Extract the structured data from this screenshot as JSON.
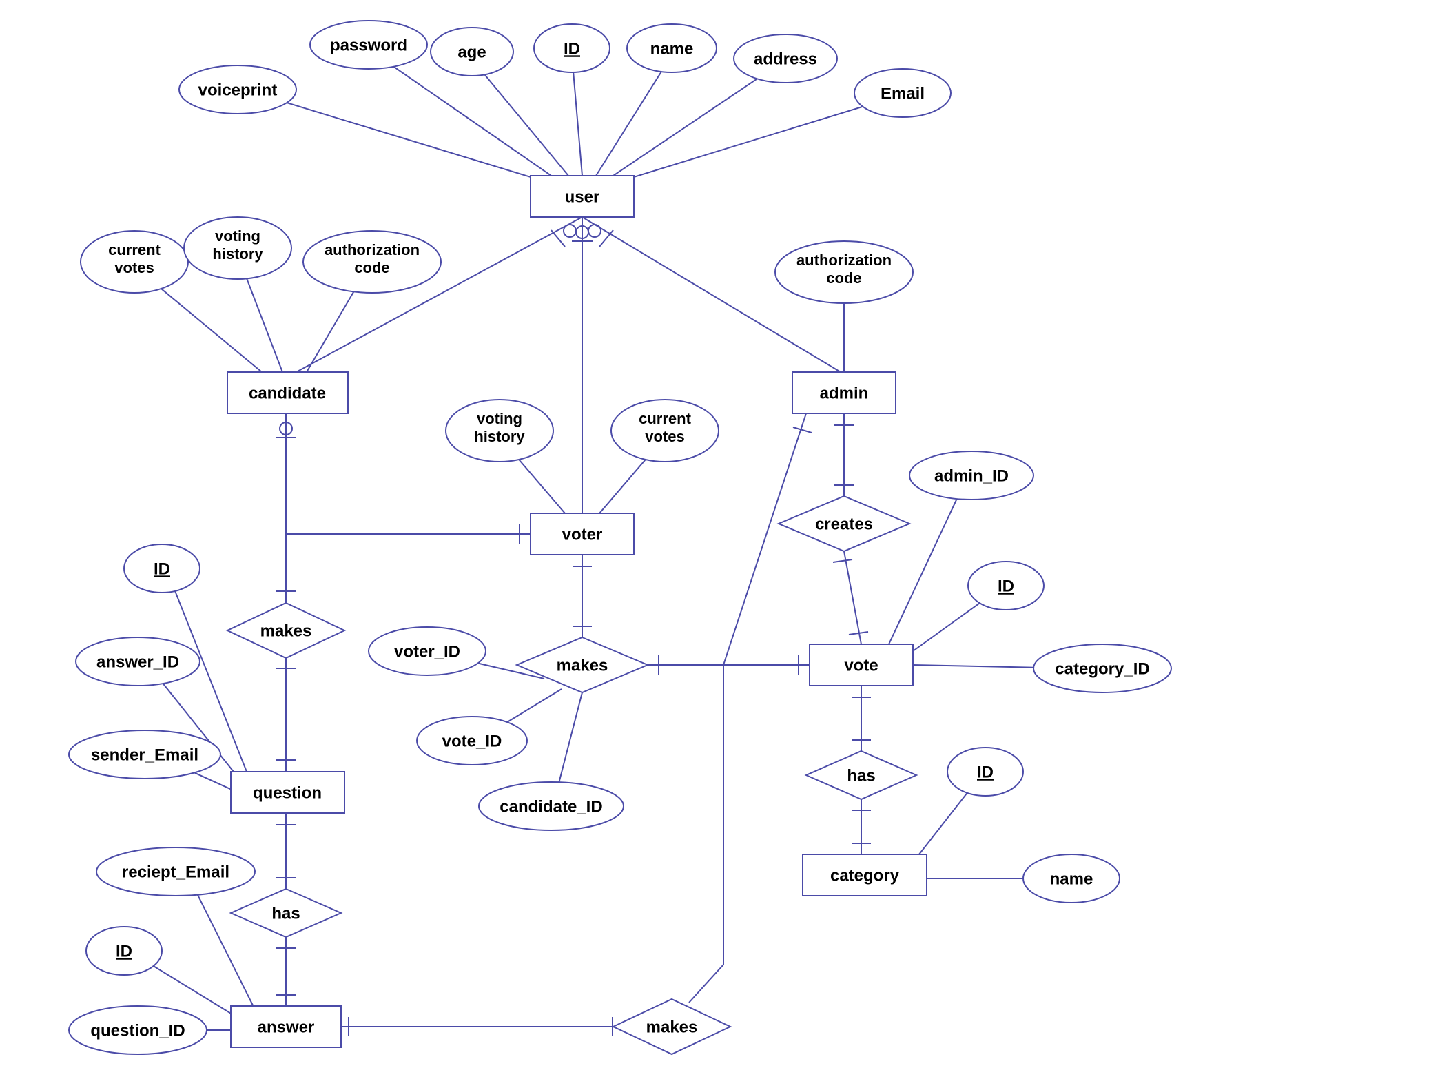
{
  "entities": {
    "user": "user",
    "candidate": "candidate",
    "voter": "voter",
    "admin": "admin",
    "question": "question",
    "answer": "answer",
    "vote": "vote",
    "category": "category"
  },
  "relationships": {
    "makes_candidate_question": "makes",
    "makes_voter_vote": "makes",
    "makes_admin_answer": "makes",
    "creates": "creates",
    "has_question_answer": "has",
    "has_vote_category": "has"
  },
  "attributes": {
    "user": {
      "voiceprint": "voiceprint",
      "password": "password",
      "age": "age",
      "ID": "ID",
      "name": "name",
      "address": "address",
      "Email": "Email"
    },
    "candidate": {
      "current_votes_l1": "current",
      "current_votes_l2": "votes",
      "voting_history_l1": "voting",
      "voting_history_l2": "history",
      "authorization_code_l1": "authorization",
      "authorization_code_l2": "code"
    },
    "voter": {
      "voting_history_l1": "voting",
      "voting_history_l2": "history",
      "current_votes_l1": "current",
      "current_votes_l2": "votes"
    },
    "admin": {
      "authorization_code_l1": "authorization",
      "authorization_code_l2": "code"
    },
    "makes_voter_vote": {
      "voter_ID": "voter_ID",
      "vote_ID": "vote_ID",
      "candidate_ID": "candidate_ID"
    },
    "vote": {
      "admin_ID": "admin_ID",
      "ID": "ID",
      "category_ID": "category_ID"
    },
    "category": {
      "ID": "ID",
      "name": "name"
    },
    "question": {
      "ID": "ID",
      "answer_ID": "answer_ID",
      "sender_Email": "sender_Email"
    },
    "answer": {
      "reciept_Email": "reciept_Email",
      "ID": "ID",
      "question_ID": "question_ID"
    }
  },
  "colors": {
    "stroke": "#4b4ba8",
    "fill": "#ffffff",
    "text": "#000000"
  }
}
